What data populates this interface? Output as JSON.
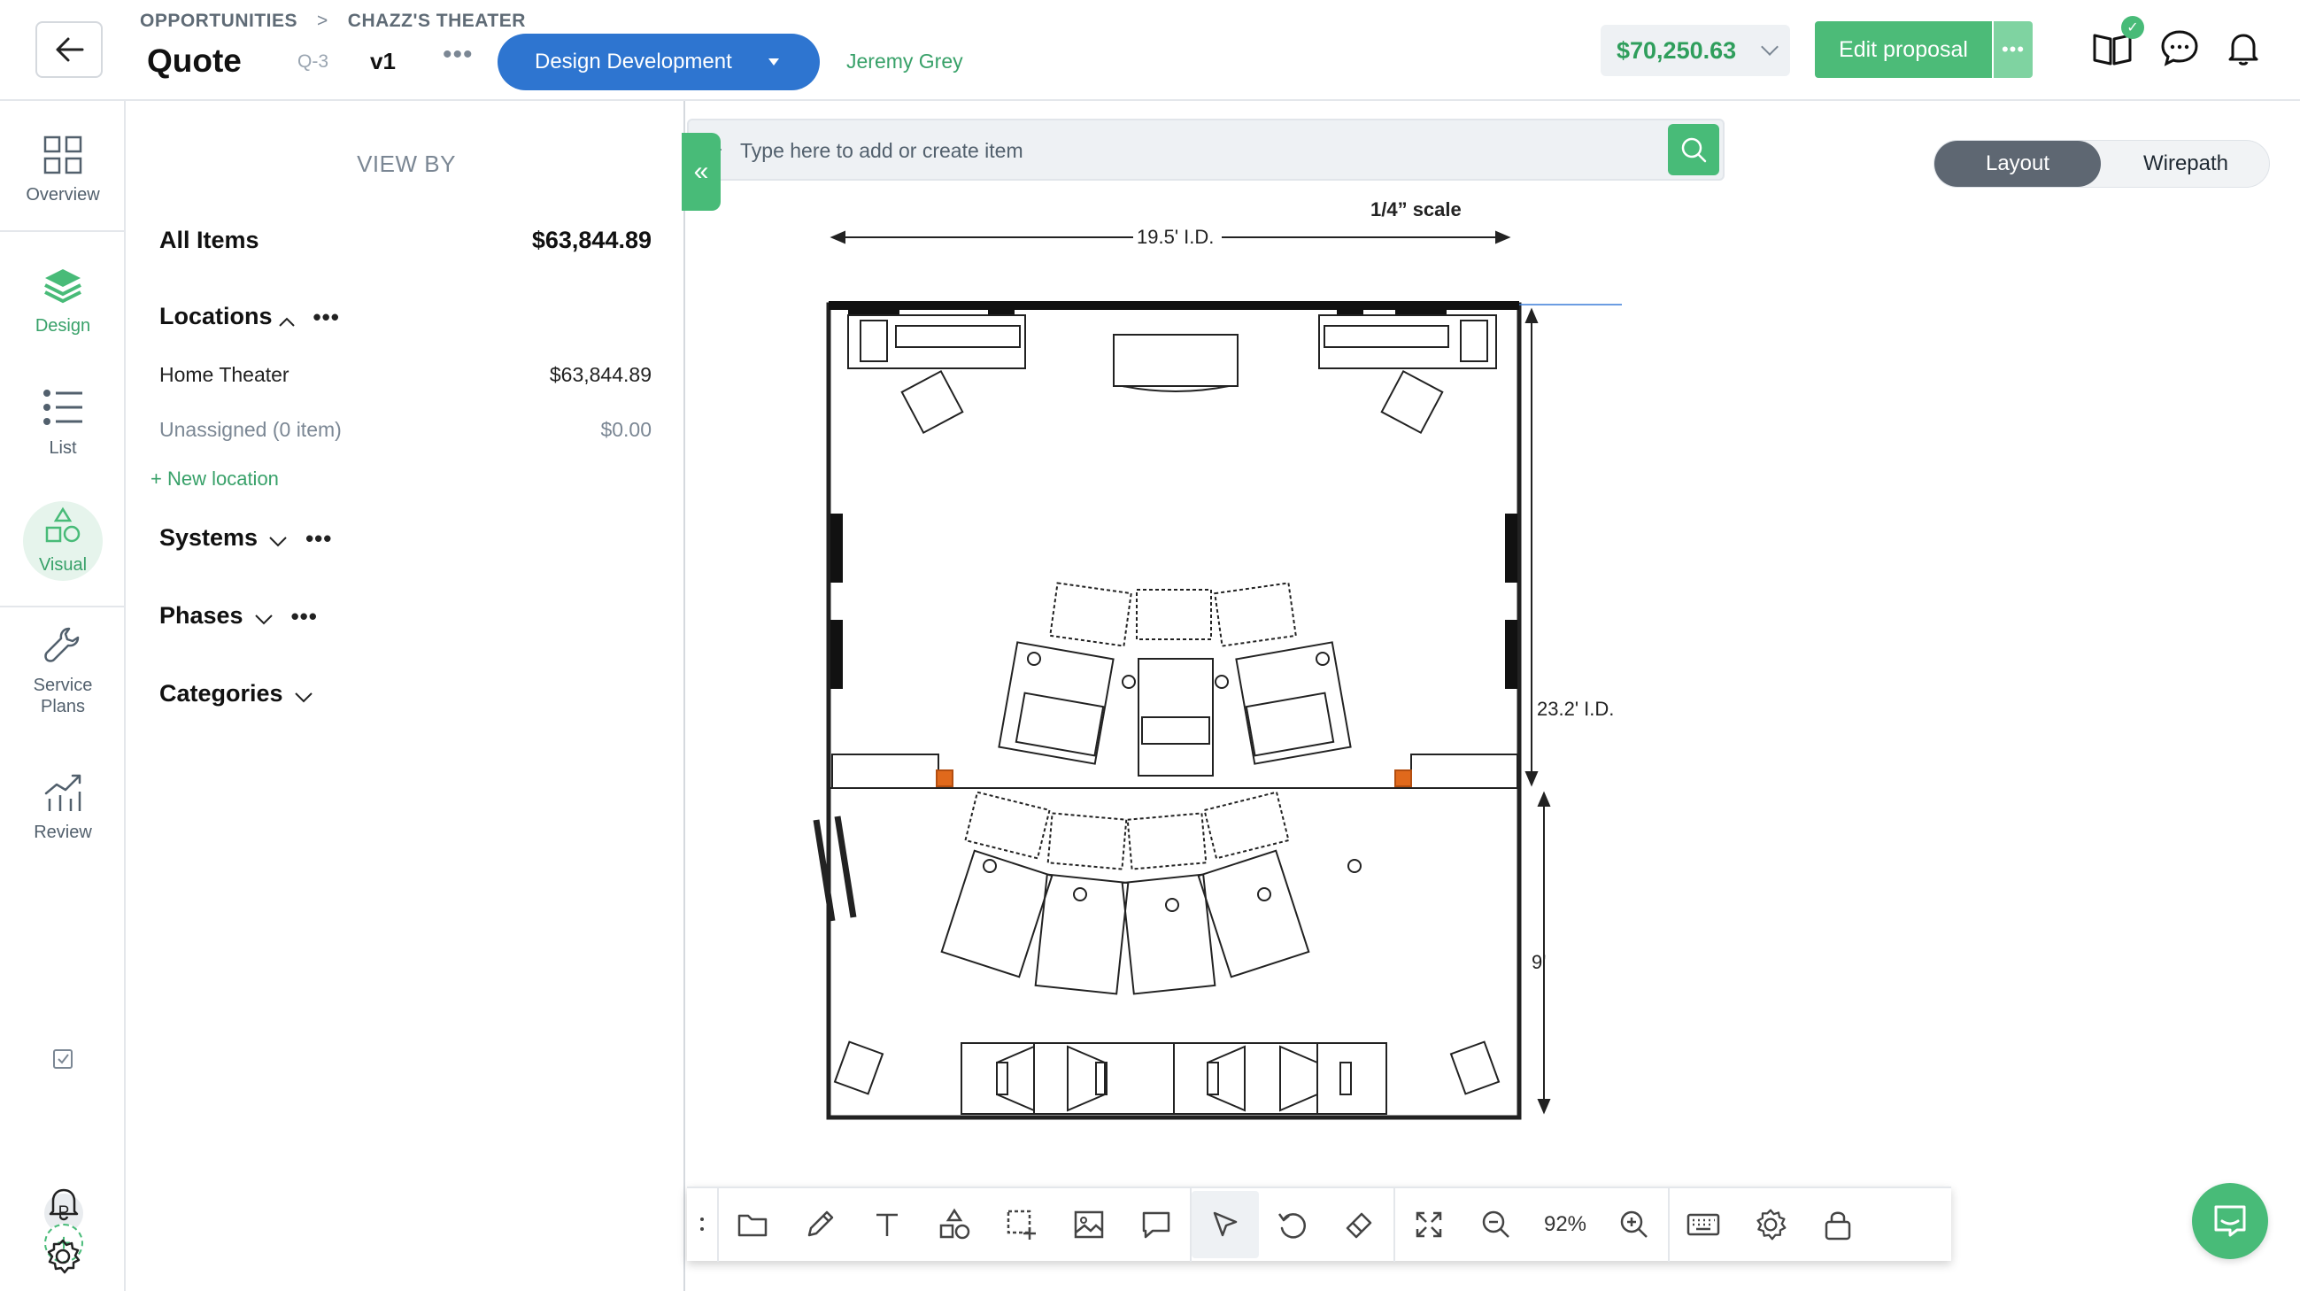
{
  "breadcrumb": {
    "root": "OPPORTUNITIES",
    "separator": ">",
    "current": "CHAZZ'S THEATER"
  },
  "header": {
    "title": "Quote",
    "quote_id": "Q-3",
    "version": "v1",
    "more": "•••",
    "phase": "Design Development",
    "owner": "Jeremy Grey",
    "total": "$70,250.63",
    "edit_label": "Edit proposal",
    "edit_more": "•••",
    "icons": [
      "book-icon",
      "chat-bubble-icon",
      "bell-icon"
    ]
  },
  "rail": {
    "items": [
      {
        "label": "Overview",
        "icon": "grid-icon"
      },
      {
        "label": "Design",
        "icon": "layers-icon",
        "active": true
      },
      {
        "label": "List",
        "icon": "list-icon"
      },
      {
        "label": "Visual",
        "icon": "shapes-icon",
        "active": true
      },
      {
        "label": "Service",
        "label2": "Plans",
        "icon": "wrench-icon"
      },
      {
        "label": "Review",
        "icon": "chart-icon"
      }
    ],
    "avatar": "P",
    "avatar_add": "+"
  },
  "panel": {
    "heading": "VIEW BY",
    "all_items": {
      "label": "All Items",
      "value": "$63,844.89"
    },
    "locations": {
      "label": "Locations",
      "items": [
        {
          "label": "Home Theater",
          "value": "$63,844.89"
        },
        {
          "label": "Unassigned (0 item)",
          "value": "$0.00"
        }
      ],
      "new_label": "+ New location"
    },
    "systems": "Systems",
    "phases": "Phases",
    "categories": "Categories",
    "dots": "•••"
  },
  "canvas": {
    "search_placeholder": "Type here to add or create item",
    "collapse": "«",
    "toggle": {
      "active": "Layout",
      "inactive": "Wirepath"
    },
    "plan": {
      "scale_label": "1/4” scale",
      "width_label": "19.5' I.D.",
      "height_label": "23.2' I.D.",
      "rear_depth_label": "9'"
    }
  },
  "toolbar": {
    "zoom": "92%",
    "tools": [
      "folder-icon",
      "pencil-icon",
      "text-icon",
      "shapes-icon",
      "select-area-icon",
      "image-icon",
      "comment-icon",
      "cursor-icon",
      "undo-icon",
      "eraser-icon",
      "fit-screen-icon",
      "zoom-out-icon",
      "zoom-in-icon",
      "keyboard-icon",
      "settings-icon",
      "lock-icon"
    ]
  },
  "colors": {
    "accent_green": "#48bb78",
    "phase_blue": "#2e75d0",
    "total_green": "#2f9e5c",
    "speaker_orange": "#e0691c"
  }
}
